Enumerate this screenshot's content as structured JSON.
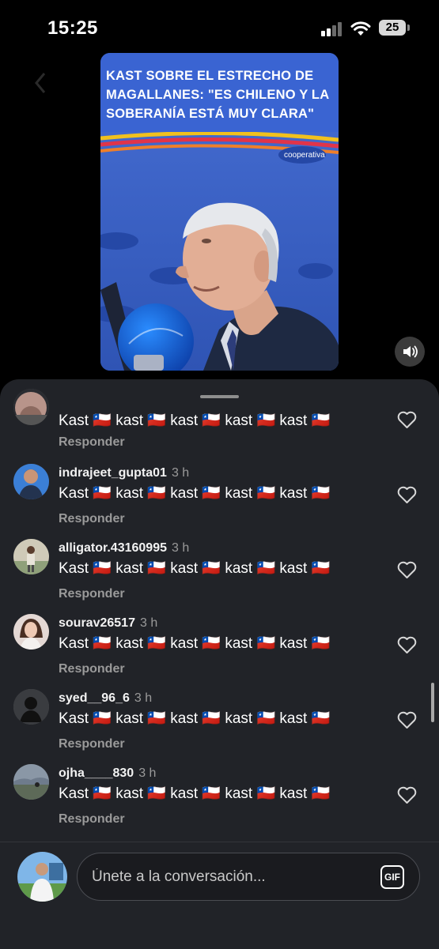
{
  "status_bar": {
    "time": "15:25",
    "battery": "25",
    "signal_icon": "cellular-signal-icon",
    "wifi_icon": "wifi-icon"
  },
  "video": {
    "caption": "KAST SOBRE EL ESTRECHO DE MAGALLANES: \"ES CHILENO Y LA SOBERANÍA ESTÁ MUY CLARA\"",
    "logo_text": "cooperativa",
    "caption_color": "#3a64d2",
    "volume_icon": "speaker-icon"
  },
  "comments": [
    {
      "username": "",
      "time": "",
      "text": "Kast 🇨🇱 kast 🇨🇱 kast 🇨🇱 kast 🇨🇱 kast 🇨🇱",
      "reply": "Responder",
      "like_icon": "heart-outline-icon"
    },
    {
      "username": "indrajeet_gupta01",
      "time": "3 h",
      "text": "Kast 🇨🇱 kast 🇨🇱 kast 🇨🇱 kast 🇨🇱 kast 🇨🇱",
      "reply": "Responder",
      "like_icon": "heart-outline-icon"
    },
    {
      "username": "alligator.43160995",
      "time": "3 h",
      "text": "Kast 🇨🇱 kast 🇨🇱 kast 🇨🇱 kast 🇨🇱 kast 🇨🇱",
      "reply": "Responder",
      "like_icon": "heart-outline-icon"
    },
    {
      "username": "sourav26517",
      "time": "3 h",
      "text": "Kast 🇨🇱 kast 🇨🇱 kast 🇨🇱 kast 🇨🇱 kast 🇨🇱",
      "reply": "Responder",
      "like_icon": "heart-outline-icon"
    },
    {
      "username": "syed__96_6",
      "time": "3 h",
      "text": "Kast 🇨🇱 kast 🇨🇱 kast 🇨🇱 kast 🇨🇱 kast 🇨🇱",
      "reply": "Responder",
      "like_icon": "heart-outline-icon"
    },
    {
      "username": "ojha____830",
      "time": "3 h",
      "text": "Kast 🇨🇱 kast 🇨🇱 kast 🇨🇱 kast 🇨🇱 kast 🇨🇱",
      "reply": "Responder",
      "like_icon": "heart-outline-icon"
    }
  ],
  "composer": {
    "placeholder": "Únete a la conversación...",
    "gif_label": "GIF"
  }
}
